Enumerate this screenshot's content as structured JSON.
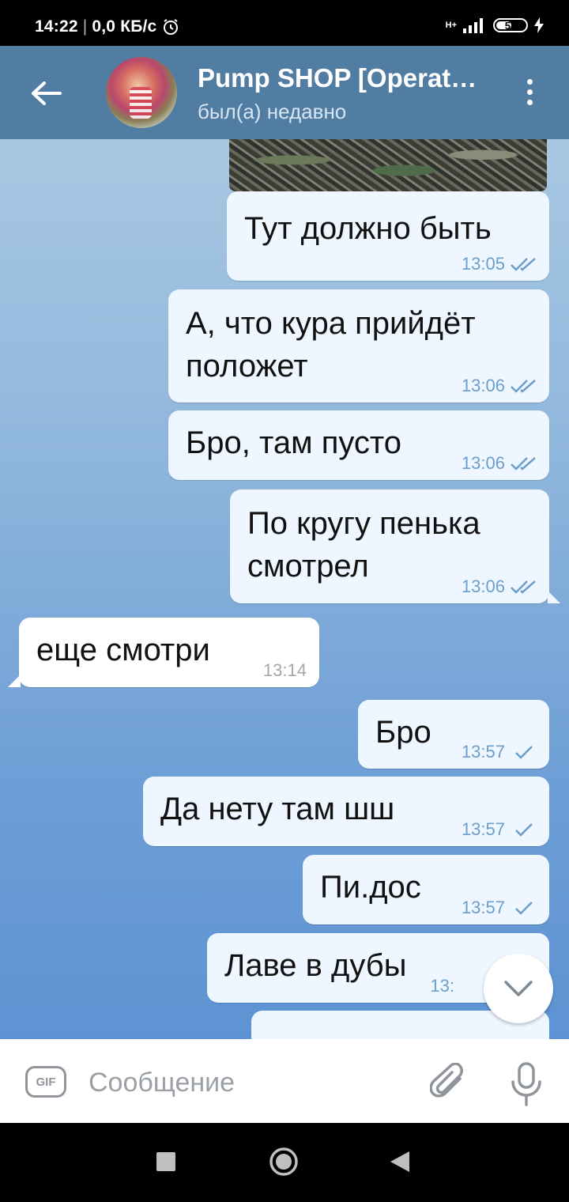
{
  "status_bar": {
    "time": "14:22",
    "network_speed": "0,0 КБ/с",
    "alarm_icon": "alarm-icon",
    "network_type": "H+",
    "battery_level": "52",
    "charging_icon": "bolt-icon"
  },
  "header": {
    "back_icon": "arrow-left-icon",
    "title": "Pump SHOP [Operat…",
    "status": "был(а) недавно",
    "menu_icon": "more-vertical-icon"
  },
  "messages": [
    {
      "dir": "out",
      "text": "Тут должно быть",
      "time": "13:05",
      "status": "read"
    },
    {
      "dir": "out",
      "text": "А, что кура прийдёт\nположет",
      "time": "13:06",
      "status": "read"
    },
    {
      "dir": "out",
      "text": "Бро, там пусто",
      "time": "13:06",
      "status": "read"
    },
    {
      "dir": "out",
      "text": "По кругу пенька\nсмотрел",
      "time": "13:06",
      "status": "read"
    },
    {
      "dir": "in",
      "text": "еще смотри",
      "time": "13:14"
    },
    {
      "dir": "out",
      "text": "Бро",
      "time": "13:57",
      "status": "sent"
    },
    {
      "dir": "out",
      "text": "Да нету там шш",
      "time": "13:57",
      "status": "sent"
    },
    {
      "dir": "out",
      "text": "Пи.дос",
      "time": "13:57",
      "status": "sent"
    },
    {
      "dir": "out",
      "text": "Лаве в дубы",
      "time": "13:",
      "status": "sent"
    }
  ],
  "input_bar": {
    "gif_label": "GIF",
    "placeholder": "Сообщение",
    "attach_icon": "paperclip-icon",
    "mic_icon": "microphone-icon"
  },
  "nav_bar": {
    "recents_icon": "square-icon",
    "home_icon": "circle-icon",
    "back_icon": "triangle-back-icon"
  },
  "colors": {
    "header": "#527da3",
    "outgoing_bubble": "#eef6ff",
    "incoming_bubble": "#ffffff",
    "read_check": "#6d9ec9",
    "timestamp_incoming": "#a6a6a6"
  }
}
